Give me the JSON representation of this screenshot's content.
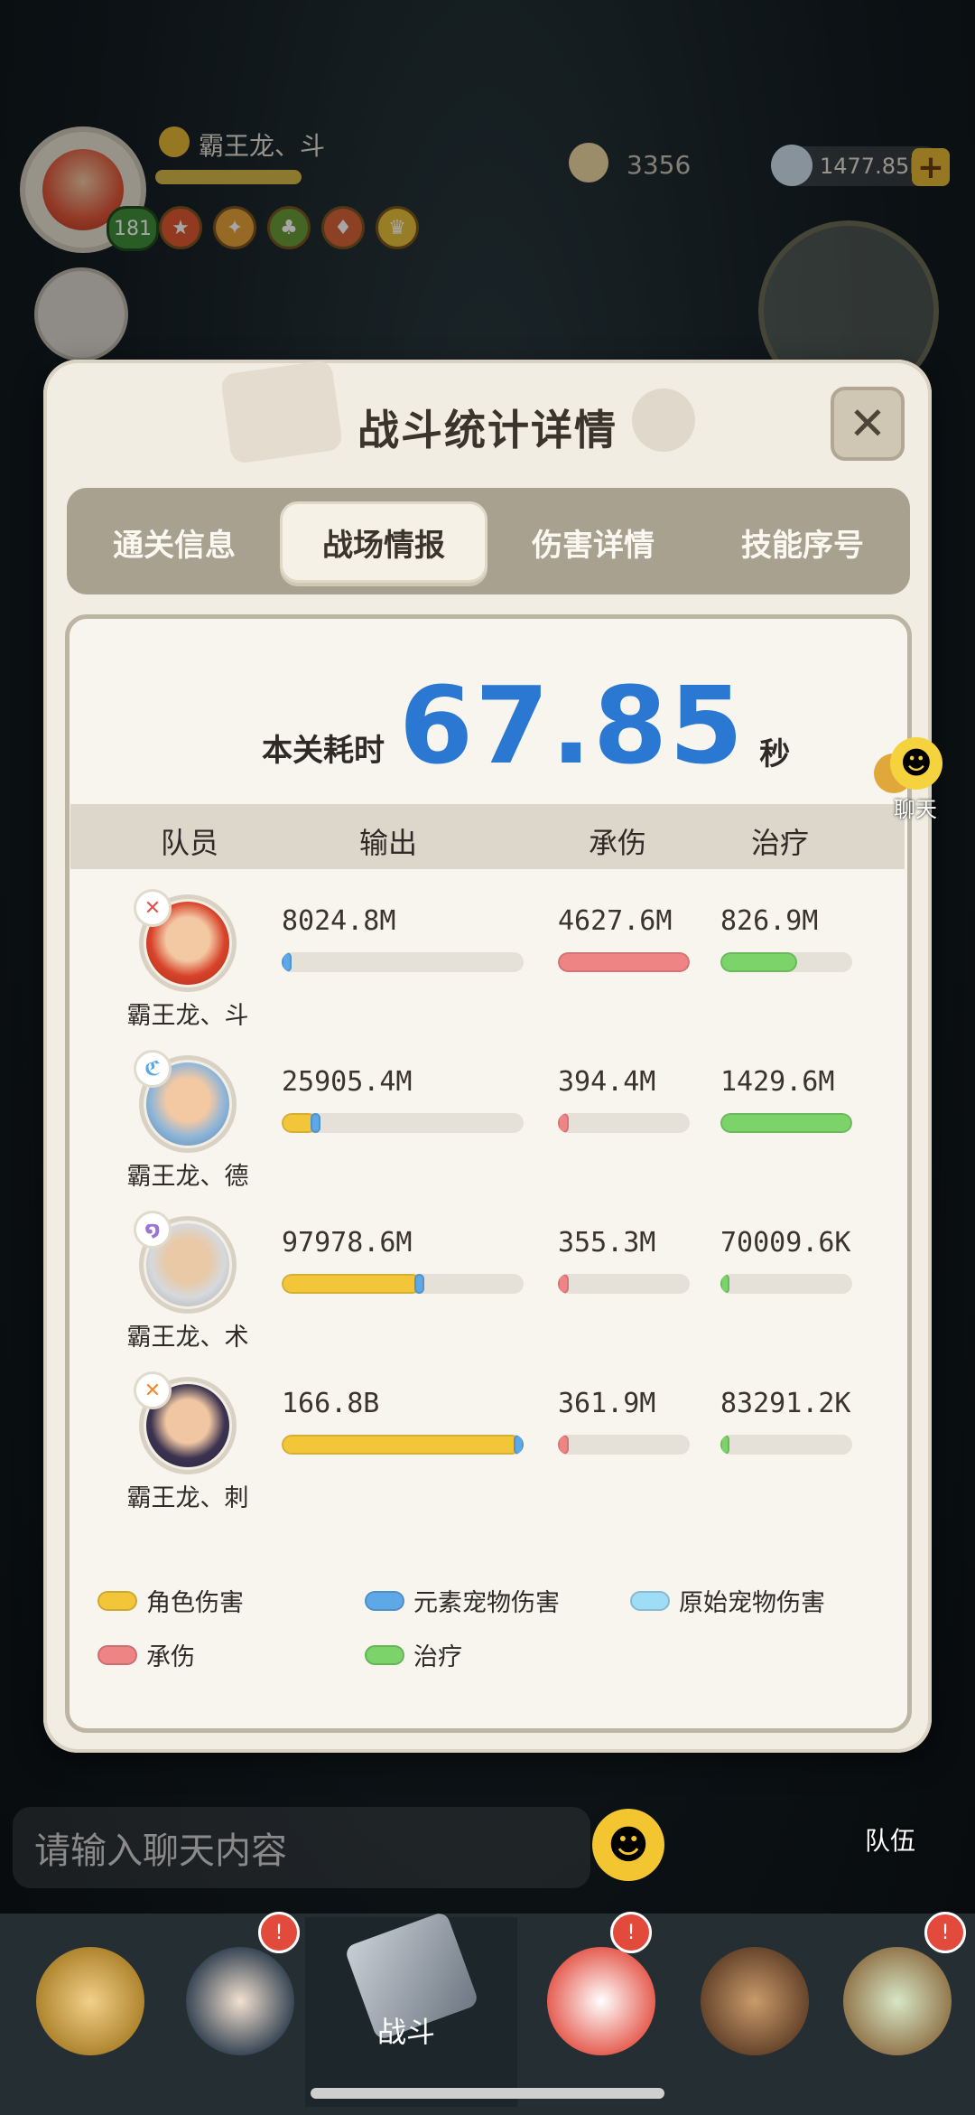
{
  "hud": {
    "player_name": "霸王龙、斗",
    "level": "181",
    "currency1": "3356",
    "currency2": "1477.85M"
  },
  "modal": {
    "title": "战斗统计详情",
    "tabs": [
      {
        "label": "通关信息",
        "active": false
      },
      {
        "label": "战场情报",
        "active": true
      },
      {
        "label": "伤害详情",
        "active": false
      },
      {
        "label": "技能序号",
        "active": false
      }
    ],
    "time_label": "本关耗时",
    "time_value": "67.85",
    "time_unit": "秒",
    "headers": {
      "member": "队员",
      "output": "输出",
      "taken": "承伤",
      "heal": "治疗"
    },
    "rows": [
      {
        "name": "霸王龙、斗",
        "output": "8024.8M",
        "taken": "4627.6M",
        "heal": "826.9M",
        "output_role": 0.0,
        "output_pet": 0.04,
        "taken_frac": 1.0,
        "heal_frac": 0.58,
        "element_icon": "fire-element-icon"
      },
      {
        "name": "霸王龙、德",
        "output": "25905.4M",
        "taken": "394.4M",
        "heal": "1429.6M",
        "output_role": 0.12,
        "output_pet": 0.04,
        "taken_frac": 0.08,
        "heal_frac": 1.0,
        "element_icon": "wind-element-icon"
      },
      {
        "name": "霸王龙、术",
        "output": "97978.6M",
        "taken": "355.3M",
        "heal": "70009.6K",
        "output_role": 0.55,
        "output_pet": 0.04,
        "taken_frac": 0.07,
        "heal_frac": 0.05,
        "element_icon": "arcane-element-icon"
      },
      {
        "name": "霸王龙、刺",
        "output": "166.8B",
        "taken": "361.9M",
        "heal": "83291.2K",
        "output_role": 0.96,
        "output_pet": 0.04,
        "taken_frac": 0.07,
        "heal_frac": 0.06,
        "element_icon": "fire-element-icon"
      }
    ],
    "legend": [
      {
        "label": "角色伤害",
        "color": "#f3c63a"
      },
      {
        "label": "元素宠物伤害",
        "color": "#5fa8e8"
      },
      {
        "label": "原始宠物伤害",
        "color": "#9fdcf5"
      },
      {
        "label": "承伤",
        "color": "#ef8484"
      },
      {
        "label": "治疗",
        "color": "#7bd36a"
      }
    ]
  },
  "chat": {
    "bubble_label": "聊天",
    "input_placeholder": "请输入聊天内容",
    "team_label": "队伍"
  },
  "nav": {
    "battle_label": "战斗"
  },
  "colors": {
    "accent_blue": "#2a78d2",
    "role_damage": "#f3c63a",
    "elem_pet": "#5fa8e8",
    "taken": "#ef8484",
    "heal": "#7bd36a"
  }
}
